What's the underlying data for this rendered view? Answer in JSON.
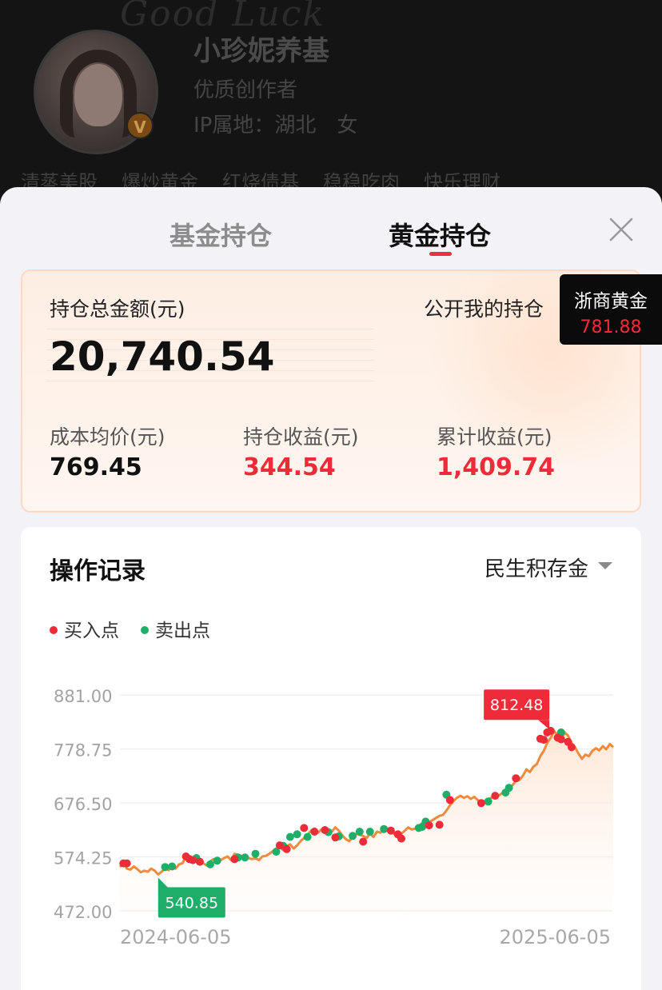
{
  "profile": {
    "scribble": "Good Luck",
    "name": "小珍妮养基",
    "subtitle": "优质创作者",
    "location": "IP属地：湖北",
    "gender": "女",
    "badge": "V",
    "tags": [
      "清蒸美股",
      "爆炒黄金",
      "红烧债基",
      "稳稳吃肉",
      "快乐理财"
    ]
  },
  "tabs": [
    {
      "label": "基金持仓",
      "active": false
    },
    {
      "label": "黄金持仓",
      "active": true
    }
  ],
  "summary": {
    "total_label": "持仓总金额(元)",
    "total_value": "20,740.54",
    "public_label": "公开我的持仓",
    "cost_label": "成本均价(元)",
    "cost_value": "769.45",
    "hold_label": "持仓收益(元)",
    "hold_value": "344.54",
    "cum_label": "累计收益(元)",
    "cum_value": "1,409.74"
  },
  "gold_tip": {
    "name": "浙商黄金",
    "value": "781.88"
  },
  "records": {
    "title": "操作记录",
    "selected": "民生积存金",
    "legend_buy": "买入点",
    "legend_sell": "卖出点"
  },
  "colors": {
    "accent_red": "#ee2b39",
    "sell_green": "#1fae6a",
    "line_orange": "#f08a3c"
  },
  "chart_data": {
    "type": "line",
    "x_start": "2024-06-05",
    "x_end": "2025-06-05",
    "y_ticks": [
      "881.00",
      "778.75",
      "676.50",
      "574.25",
      "472.00"
    ],
    "ylim": [
      472.0,
      881.0
    ],
    "high_label": "812.48",
    "low_label": "540.85",
    "series": [
      {
        "values": [
          555,
          562,
          552,
          550,
          556,
          551,
          545,
          548,
          546,
          552,
          548,
          540.85,
          546,
          552,
          549,
          555,
          552,
          560,
          562,
          575,
          568,
          572,
          565,
          560,
          562,
          558,
          566,
          570,
          564,
          568,
          572,
          575,
          568,
          580,
          578,
          576,
          575,
          572,
          570,
          572,
          568,
          575,
          576,
          580,
          585,
          590,
          592,
          587,
          595,
          598,
          590,
          596,
          604,
          610,
          616,
          624,
          628,
          620,
          626,
          630,
          624,
          622,
          630,
          624,
          615,
          608,
          604,
          612,
          618,
          616,
          614,
          610,
          618,
          612,
          622,
          620,
          626,
          628,
          624,
          617,
          622,
          618,
          624,
          630,
          626,
          628,
          632,
          638,
          634,
          640,
          644,
          648,
          652,
          654,
          662,
          672,
          680,
          686,
          690,
          686,
          689,
          684,
          688,
          682,
          676,
          680,
          684,
          686,
          688,
          690,
          695,
          700,
          705,
          710,
          718,
          720,
          728,
          740,
          735,
          745,
          750,
          765,
          775,
          790,
          800,
          812.48,
          805,
          795,
          810,
          804,
          790,
          782,
          770,
          760,
          768,
          765,
          775,
          780,
          776,
          784,
          778,
          788,
          782
        ]
      }
    ],
    "buy_markers": [
      [
        1,
        562
      ],
      [
        2,
        562
      ],
      [
        19,
        575
      ],
      [
        20,
        570
      ],
      [
        21,
        568
      ],
      [
        23,
        565
      ],
      [
        33,
        570
      ],
      [
        46,
        596
      ],
      [
        48,
        589
      ],
      [
        53,
        629
      ],
      [
        56,
        622
      ],
      [
        59,
        625
      ],
      [
        62,
        611
      ],
      [
        70,
        603
      ],
      [
        78,
        624
      ],
      [
        80,
        617
      ],
      [
        81,
        609
      ],
      [
        89,
        634
      ],
      [
        92,
        635
      ],
      [
        95,
        682
      ],
      [
        104,
        676
      ],
      [
        108,
        690
      ],
      [
        114,
        723
      ],
      [
        121,
        798
      ],
      [
        122,
        796
      ],
      [
        123,
        810
      ],
      [
        124,
        813
      ],
      [
        126,
        800
      ],
      [
        127,
        797
      ],
      [
        129,
        792
      ],
      [
        130,
        782
      ]
    ],
    "sell_markers": [
      [
        13,
        555
      ],
      [
        15,
        556
      ],
      [
        22,
        572
      ],
      [
        26,
        560
      ],
      [
        28,
        567
      ],
      [
        34,
        573
      ],
      [
        36,
        573
      ],
      [
        39,
        580
      ],
      [
        45,
        584
      ],
      [
        47,
        595
      ],
      [
        49,
        612
      ],
      [
        51,
        617
      ],
      [
        54,
        612
      ],
      [
        60,
        621
      ],
      [
        63,
        613
      ],
      [
        67,
        614
      ],
      [
        69,
        622
      ],
      [
        72,
        622
      ],
      [
        76,
        627
      ],
      [
        86,
        629
      ],
      [
        87,
        631
      ],
      [
        88,
        641
      ],
      [
        94,
        692
      ],
      [
        106,
        679
      ],
      [
        111,
        696
      ],
      [
        112,
        705
      ],
      [
        127,
        810
      ]
    ]
  }
}
